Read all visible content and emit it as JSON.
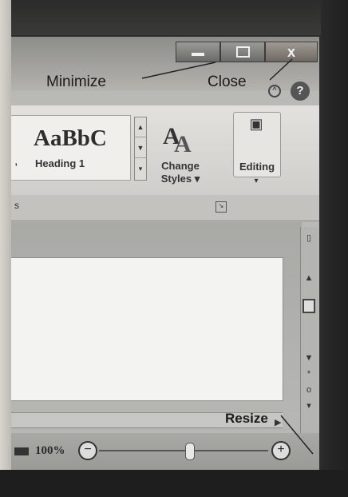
{
  "callouts": {
    "minimize": "Minimize",
    "close": "Close",
    "resize": "Resize"
  },
  "window_controls": {
    "minimize_icon": "minimize-icon",
    "maximize_icon": "maximize-icon",
    "close_glyph": "x"
  },
  "ribbon": {
    "style_sample": "AaBbC",
    "style_name": "Heading 1",
    "change_styles_label": "Change Styles",
    "change_styles_caret": "▾",
    "editing_label": "Editing",
    "editing_caret": "▾"
  },
  "statusbar": {
    "zoom_percent": "100%",
    "zoom_out": "−",
    "zoom_in": "+"
  },
  "help_glyph": "?"
}
